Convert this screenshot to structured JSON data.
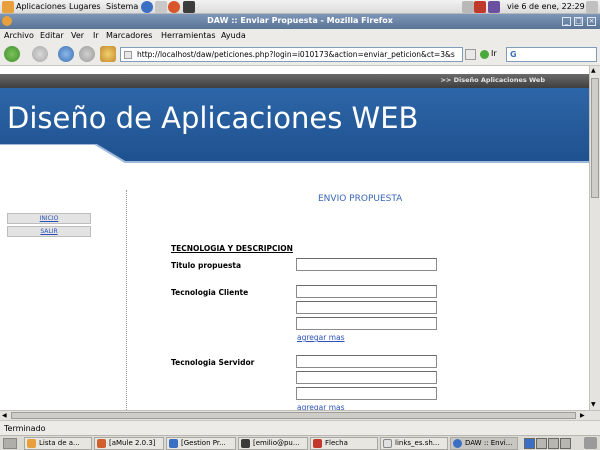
{
  "gnome_panel": {
    "menus": [
      "Aplicaciones",
      "Lugares",
      "Sistema"
    ],
    "clock": "vie  6 de ene, 22:29"
  },
  "window": {
    "title": "DAW :: Enviar Propuesta - Mozilla Firefox"
  },
  "menubar": [
    "Archivo",
    "Editar",
    "Ver",
    "Ir",
    "Marcadores",
    "Herramientas",
    "Ayuda"
  ],
  "navbar": {
    "url": "http://localhost/daw/peticiones.php?login=i010173&action=enviar_peticion&ct=3&sr=",
    "go_label": "Ir",
    "search_value": "G"
  },
  "page": {
    "header_label": ">> Diseño Aplicaciones Web",
    "banner_title": "Diseño de Aplicaciones WEB",
    "sidebar": [
      "INICIO",
      "SALIR"
    ],
    "heading": "ENVIO PROPUESTA",
    "section_title": "TECNOLOGIA Y DESCRIPCION",
    "fields": {
      "titulo_label": "Titulo propuesta",
      "cliente_label": "Tecnologia Cliente",
      "servidor_label": "Tecnologia Servidor"
    },
    "add_more": "agregar mas"
  },
  "status": "Terminado",
  "taskbar": [
    "Lista de a...",
    "[aMule 2.0.3]",
    "[Gestion Pr...",
    "[emilio@pu...",
    "Flecha",
    "links_es.sh...",
    "DAW :: Envi..."
  ],
  "colors": {
    "banner": "#1d4f8c",
    "link": "#2b52b6",
    "heading": "#3a66b5"
  }
}
